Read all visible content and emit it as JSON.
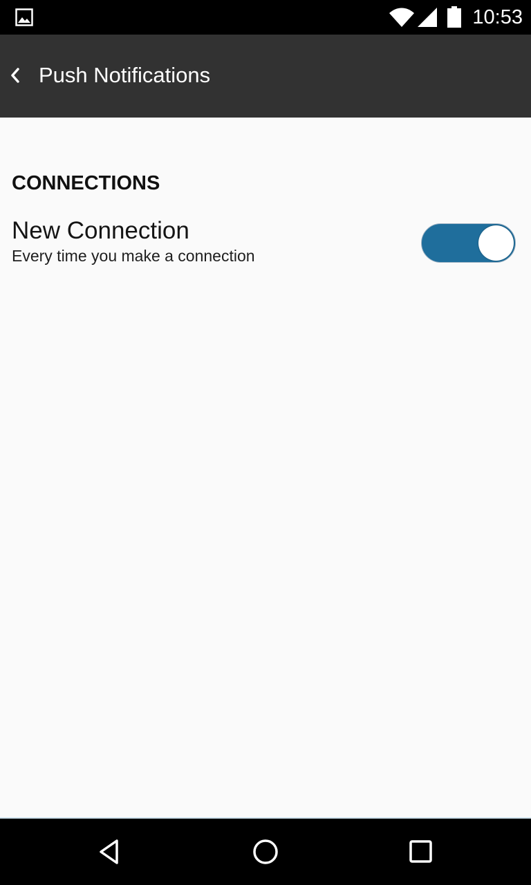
{
  "status_bar": {
    "time": "10:53",
    "icons": [
      "gallery-icon",
      "wifi-icon",
      "signal-icon",
      "battery-icon"
    ]
  },
  "app_bar": {
    "title": "Push Notifications",
    "back_icon": "chevron-left-icon"
  },
  "section": {
    "header": "CONNECTIONS"
  },
  "setting": {
    "title": "New Connection",
    "subtitle": "Every time you make a connection",
    "enabled": true,
    "accent_color": "#1f6e9c"
  },
  "nav_bar": {
    "icons": [
      "back-triangle-icon",
      "home-circle-icon",
      "recents-square-icon"
    ]
  },
  "colors": {
    "app_bar_bg": "#323232",
    "page_bg": "#fafafa",
    "status_bar_bg": "#000000"
  }
}
